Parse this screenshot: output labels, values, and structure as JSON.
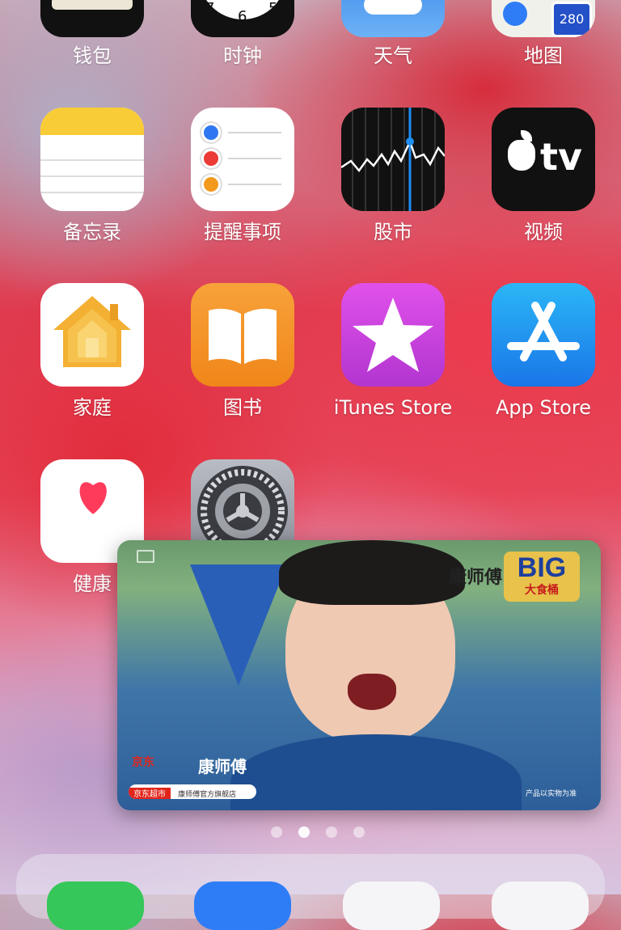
{
  "top_row": [
    {
      "label": "钱包",
      "icon": "wallet-icon"
    },
    {
      "label": "时钟",
      "icon": "clock-icon"
    },
    {
      "label": "天气",
      "icon": "weather-icon"
    },
    {
      "label": "地图",
      "icon": "maps-icon",
      "badge": "280"
    }
  ],
  "row2": [
    {
      "label": "备忘录",
      "icon": "notes-icon"
    },
    {
      "label": "提醒事项",
      "icon": "reminders-icon"
    },
    {
      "label": "股市",
      "icon": "stocks-icon"
    },
    {
      "label": "视频",
      "icon": "apple-tv-icon",
      "icon_text": "tv"
    }
  ],
  "row3": [
    {
      "label": "家庭",
      "icon": "home-icon"
    },
    {
      "label": "图书",
      "icon": "books-icon"
    },
    {
      "label": "iTunes Store",
      "icon": "star-icon"
    },
    {
      "label": "App Store",
      "icon": "app-store-icon"
    }
  ],
  "row4": [
    {
      "label": "健康",
      "icon": "health-heart-icon"
    },
    {
      "label": "",
      "icon": "settings-gear-icon"
    }
  ],
  "pip_video": {
    "brand_text": "康师傅",
    "badge_title": "BIG",
    "badge_sub": "大食桶",
    "store_text": "京东超市",
    "search_text": "康师傅官方旗舰店",
    "corner_text": "产品以实物为准",
    "jd_text": "京东"
  },
  "page_dots": {
    "count": 4,
    "active_index": 1
  },
  "colors": {
    "wallpaper_red": "#e23c50",
    "icon_blue": "#1f8ef2",
    "icon_orange": "#f39a1e",
    "icon_purple": "#c940d8"
  }
}
